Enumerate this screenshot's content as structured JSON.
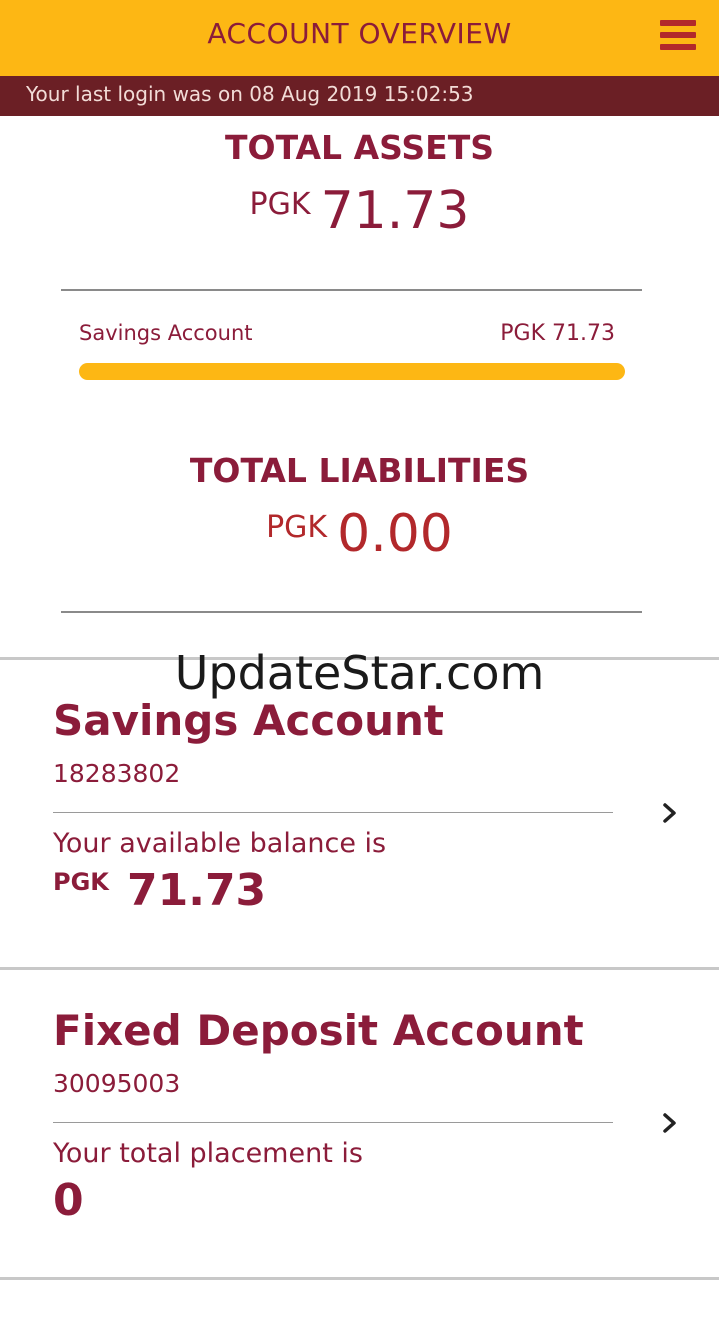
{
  "header": {
    "title": "ACCOUNT OVERVIEW",
    "menu_icon": "hamburger-menu-icon"
  },
  "login_bar": {
    "text": "Your last login was on 08 Aug 2019 15:02:53"
  },
  "assets": {
    "label": "TOTAL ASSETS",
    "currency": "PGK",
    "amount": "71.73",
    "breakdown": {
      "label": "Savings Account",
      "amount": "PGK 71.73",
      "share": 1.0
    }
  },
  "liabilities": {
    "label": "TOTAL LIABILITIES",
    "currency": "PGK",
    "amount": "0.00"
  },
  "watermark": "UpdateStar.com",
  "accounts": [
    {
      "title": "Savings Account",
      "number": "18283802",
      "caption": "Your available balance is",
      "currency": "PGK",
      "amount": "71.73",
      "chevron_icon": "chevron-right-icon"
    },
    {
      "title": "Fixed Deposit Account",
      "number": "30095003",
      "caption": "Your total placement is",
      "currency": "",
      "amount": "0",
      "chevron_icon": "chevron-right-icon"
    }
  ],
  "colors": {
    "brand_yellow": "#fdb714",
    "brand_maroon": "#8b1c3a",
    "login_bar": "#6b1f25",
    "liability_red": "#b2282b"
  }
}
